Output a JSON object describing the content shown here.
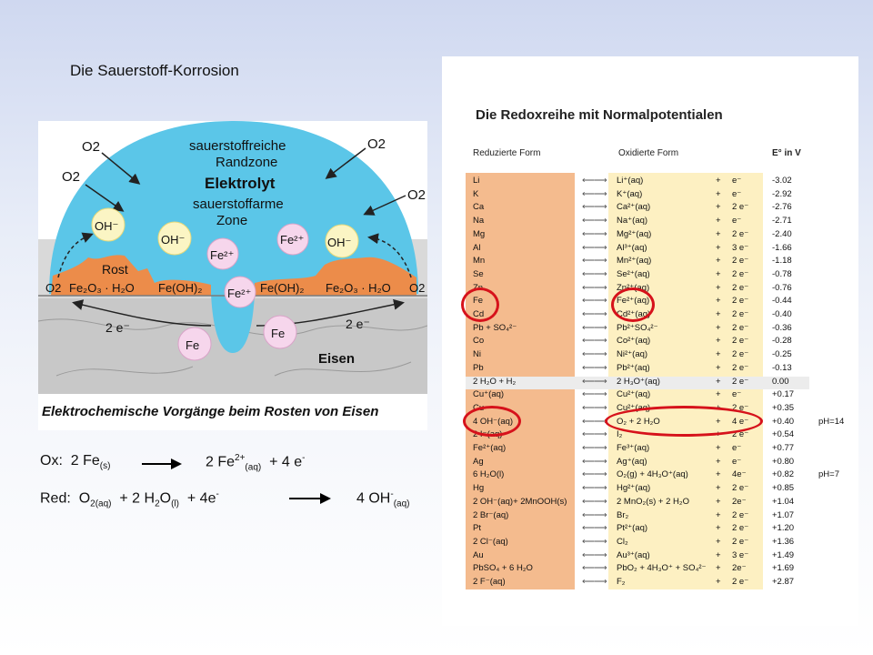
{
  "slide": {
    "title": "Die Sauerstoff-Korrosion"
  },
  "figure": {
    "caption": "Elektrochemische Vorgänge beim Rosten von Eisen",
    "labels": {
      "o2": "O2",
      "zone_rich": [
        "sauerstoffreiche",
        "Randzone"
      ],
      "elektrolyt": "Elektrolyt",
      "zone_poor": [
        "sauerstoffarme",
        "Zone"
      ],
      "oh": "OH⁻",
      "fe2": "Fe²⁺",
      "fe": "Fe",
      "rost": "Rost",
      "fe2o3": "Fe₂O₃ · H₂O",
      "feoh2": "Fe(OH)₂",
      "electrons": "2 e⁻",
      "eisen": "Eisen"
    }
  },
  "equations": {
    "ox_label": "Ox:",
    "ox_left": "2 Fe",
    "ox_left_sub": "(s)",
    "ox_right": "2 Fe",
    "ox_right_sup": "2+",
    "ox_right_sub": "(aq)",
    "ox_right_tail": "+  4 e",
    "ox_right_tail_sup": "-",
    "red_label": "Red:",
    "red_o": "O",
    "red_o_sub": "2(aq)",
    "red_mid": "+  2 H",
    "red_h_sub": "2",
    "red_o2": "O",
    "red_o2_sub": "(l)",
    "red_tail": "+  4e",
    "red_tail_sup": "-",
    "red_right": "4 OH",
    "red_right_sup": "-",
    "red_right_sub": "(aq)"
  },
  "table": {
    "title": "Die Redoxreihe  mit Normalpotentialen",
    "headers": {
      "reduced": "Reduzierte Form",
      "oxidized": "Oxidierte Form",
      "potential": "E° in V"
    },
    "arrow": "⟵⟶",
    "rows": [
      {
        "red": "Li",
        "ox": "Li⁺(aq)",
        "plus": "+",
        "e": "e⁻",
        "pot": "-3.02",
        "note": ""
      },
      {
        "red": "K",
        "ox": "K⁺(aq)",
        "plus": "+",
        "e": "e⁻",
        "pot": "-2.92",
        "note": ""
      },
      {
        "red": "Ca",
        "ox": "Ca²⁺(aq)",
        "plus": "+",
        "e": "2 e⁻",
        "pot": "-2.76",
        "note": ""
      },
      {
        "red": "Na",
        "ox": "Na⁺(aq)",
        "plus": "+",
        "e": "e⁻",
        "pot": "-2.71",
        "note": ""
      },
      {
        "red": "Mg",
        "ox": "Mg²⁺(aq)",
        "plus": "+",
        "e": "2 e⁻",
        "pot": "-2.40",
        "note": ""
      },
      {
        "red": "Al",
        "ox": "Al³⁺(aq)",
        "plus": "+",
        "e": "3 e⁻",
        "pot": "-1.66",
        "note": ""
      },
      {
        "red": "Mn",
        "ox": "Mn²⁺(aq)",
        "plus": "+",
        "e": "2 e⁻",
        "pot": "-1.18",
        "note": ""
      },
      {
        "red": "Se",
        "ox": "Se²⁺(aq)",
        "plus": "+",
        "e": "2 e⁻",
        "pot": "-0.78",
        "note": ""
      },
      {
        "red": "Zn",
        "ox": "Zn²⁺(aq)",
        "plus": "+",
        "e": "2 e⁻",
        "pot": "-0.76",
        "note": ""
      },
      {
        "red": "Fe",
        "ox": "Fe²⁺(aq)",
        "plus": "+",
        "e": "2 e⁻",
        "pot": "-0.44",
        "note": ""
      },
      {
        "red": "Cd",
        "ox": "Cd²⁺(aq)",
        "plus": "+",
        "e": "2 e⁻",
        "pot": "-0.40",
        "note": ""
      },
      {
        "red": "Pb     +   SO₄²⁻",
        "ox": "Pb²⁺SO₄²⁻",
        "plus": "+",
        "e": "2 e⁻",
        "pot": "-0.36",
        "note": ""
      },
      {
        "red": "Co",
        "ox": "Co²⁺(aq)",
        "plus": "+",
        "e": "2 e⁻",
        "pot": "-0.28",
        "note": ""
      },
      {
        "red": "Ni",
        "ox": "Ni²⁺(aq)",
        "plus": "+",
        "e": "2 e⁻",
        "pot": "-0.25",
        "note": ""
      },
      {
        "red": "Pb",
        "ox": "Pb²⁺(aq)",
        "plus": "+",
        "e": "2 e⁻",
        "pot": "-0.13",
        "note": ""
      },
      {
        "red": "2 H₂O  +    H₂",
        "ox": "2 H₃O⁺(aq)",
        "plus": "+",
        "e": "2 e⁻",
        "pot": "0.00",
        "note": ""
      },
      {
        "red": "Cu⁺(aq)",
        "ox": "Cu²⁺(aq)",
        "plus": "+",
        "e": "e⁻",
        "pot": "+0.17",
        "note": ""
      },
      {
        "red": "Cu",
        "ox": "Cu²⁺(aq)",
        "plus": "+",
        "e": "2 e⁻",
        "pot": "+0.35",
        "note": ""
      },
      {
        "red": "4 OH⁻(aq)",
        "ox": "O₂   +   2  H₂O",
        "plus": "+",
        "e": "4 e⁻",
        "pot": "+0.40",
        "note": "pH=14"
      },
      {
        "red": "2 I⁻(aq)",
        "ox": "I₂",
        "plus": "+",
        "e": "2 e⁻",
        "pot": "+0.54",
        "note": ""
      },
      {
        "red": "Fe²⁺(aq)",
        "ox": "Fe³⁺(aq)",
        "plus": "+",
        "e": "e⁻",
        "pot": "+0.77",
        "note": ""
      },
      {
        "red": "Ag",
        "ox": "Ag⁺(aq)",
        "plus": "+",
        "e": "e⁻",
        "pot": "+0.80",
        "note": ""
      },
      {
        "red": "6 H₂O(l)",
        "ox": "O₂(g) + 4H₃O⁺(aq)",
        "plus": "+",
        "e": "4e⁻",
        "pot": "+0.82",
        "note": "pH=7"
      },
      {
        "red": "Hg",
        "ox": "Hg²⁺(aq)",
        "plus": "+",
        "e": "2 e⁻",
        "pot": "+0.85",
        "note": ""
      },
      {
        "red": "2 OH⁻(aq)+ 2MnOOH(s)",
        "ox": "2 MnO₂(s) + 2 H₂O",
        "plus": "+",
        "e": "2e⁻",
        "pot": "+1.04",
        "note": ""
      },
      {
        "red": "2 Br⁻(aq)",
        "ox": "Br₂",
        "plus": "+",
        "e": "2 e⁻",
        "pot": "+1.07",
        "note": ""
      },
      {
        "red": "Pt",
        "ox": "Pt²⁺(aq)",
        "plus": "+",
        "e": "2 e⁻",
        "pot": "+1.20",
        "note": ""
      },
      {
        "red": "2 Cl⁻(aq)",
        "ox": "Cl₂",
        "plus": "+",
        "e": "2 e⁻",
        "pot": "+1.36",
        "note": ""
      },
      {
        "red": "Au",
        "ox": "Au³⁺(aq)",
        "plus": "+",
        "e": "3 e⁻",
        "pot": "+1.49",
        "note": ""
      },
      {
        "red": "PbSO₄  +  6 H₂O",
        "ox": "PbO₂ + 4H₃O⁺ + SO₄²⁻",
        "plus": "+",
        "e": "2e⁻",
        "pot": "+1.69",
        "note": ""
      },
      {
        "red": "2 F⁻(aq)",
        "ox": "F₂",
        "plus": "+",
        "e": "2 e⁻",
        "pot": "+2.87",
        "note": ""
      }
    ]
  },
  "colors": {
    "highlight_circle": "#d6121b",
    "reduced_column": "#f4bb8e",
    "oxidized_column": "#fdf0c2"
  }
}
